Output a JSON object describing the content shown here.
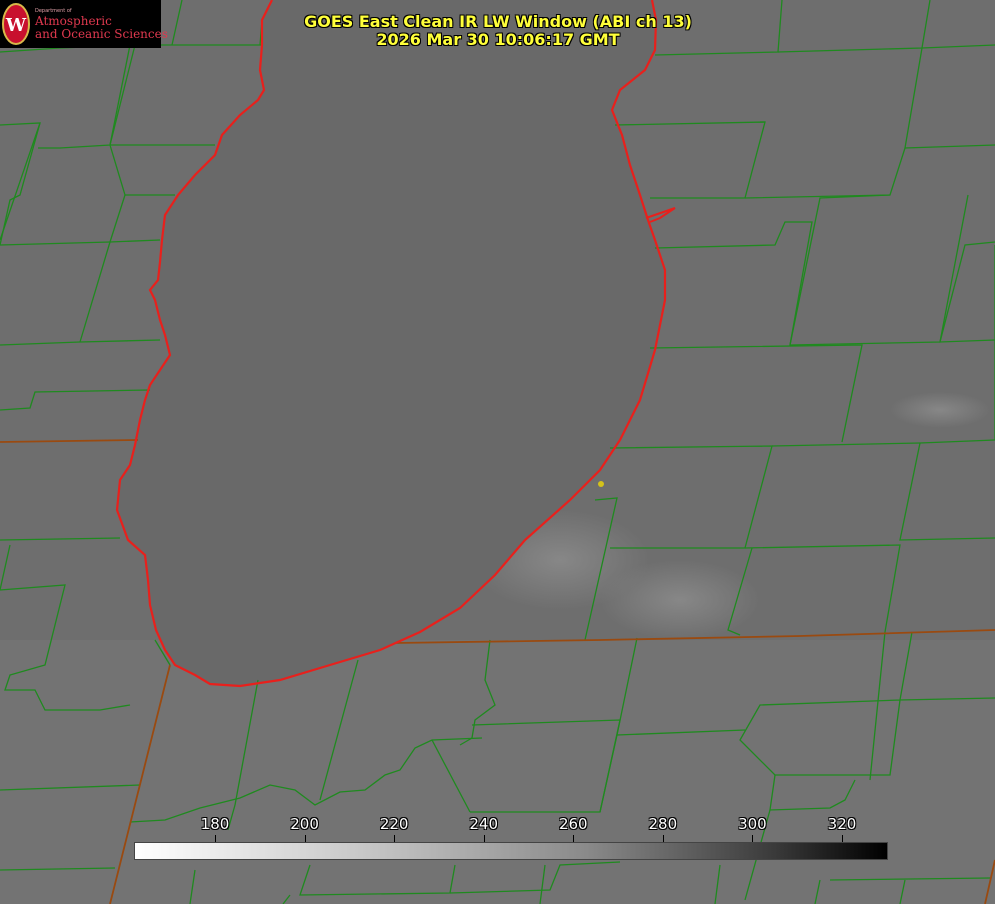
{
  "title": {
    "line1": "GOES East Clean IR LW Window (ABI ch 13)",
    "line2": "2026 Mar 30 10:06:17 GMT"
  },
  "logo": {
    "department": "Department of",
    "line1": "Atmospheric",
    "line2": "and Oceanic Sciences",
    "shield_letter": "W"
  },
  "colorbar": {
    "ticks": [
      {
        "value": 180,
        "label": "180"
      },
      {
        "value": 200,
        "label": "200"
      },
      {
        "value": 220,
        "label": "220"
      },
      {
        "value": 240,
        "label": "240"
      },
      {
        "value": 260,
        "label": "260"
      },
      {
        "value": 280,
        "label": "280"
      },
      {
        "value": 300,
        "label": "300"
      },
      {
        "value": 320,
        "label": "320"
      }
    ]
  },
  "colors": {
    "title": "#ffff3a",
    "county_lines": "#1f8a1f",
    "state_lines": "#9a4a10",
    "shoreline": "#e8201c",
    "marker": "#d4c21a",
    "logo_text": "#e0394f"
  }
}
